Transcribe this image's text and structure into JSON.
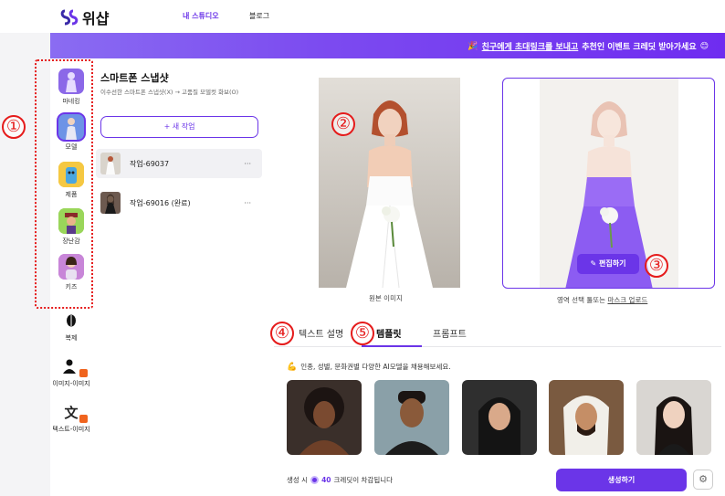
{
  "header": {
    "logo_text": "위샵",
    "nav": [
      {
        "label": "내 스튜디오",
        "active": true
      },
      {
        "label": "블로그",
        "active": false
      }
    ]
  },
  "banner": {
    "text_underlined": "친구에게 초대링크를 보내고",
    "text_rest": "추천인 이벤트 크레딧 받아가세요",
    "emoji": "😊"
  },
  "sidebar": {
    "categories": [
      {
        "label": "마네킹"
      },
      {
        "label": "모델",
        "selected": true
      },
      {
        "label": "제품"
      },
      {
        "label": "장난감"
      },
      {
        "label": "키즈"
      }
    ],
    "tools": [
      {
        "label": "복제"
      },
      {
        "label": "이미지-이미지"
      },
      {
        "label": "텍스트-이미지"
      }
    ]
  },
  "project": {
    "title": "스마트폰 스냅샷",
    "description": "이수선한 스마트폰 스냅샷(X) → 고품질 모델컷 화보(O)",
    "new_button": "+ 새 작업",
    "jobs": [
      {
        "name": "작업-69037",
        "more": "···"
      },
      {
        "name": "작업-69016 (완료)",
        "more": "···"
      }
    ]
  },
  "preview": {
    "original_caption": "원본 이미지",
    "mask_caption_prefix": "영역 선택 툴또는",
    "mask_caption_link": "마스크 업로드",
    "edit_button": "편집하기"
  },
  "tabs": [
    {
      "label": "텍스트 설명"
    },
    {
      "label": "템플릿",
      "active": true
    },
    {
      "label": "프롬프트"
    }
  ],
  "template": {
    "hint": "인종, 성별, 문화권별 다양한 AI모델을 채용해보세요.",
    "avatars": [
      "avatar-1",
      "avatar-2",
      "avatar-3",
      "avatar-4",
      "avatar-5"
    ]
  },
  "footer": {
    "credit_prefix": "생성 시",
    "credit_amount": "40",
    "credit_suffix": "크레딧이 차감됩니다",
    "generate_button": "생성하기",
    "settings_icon": "gear-icon"
  },
  "annotations": [
    "①",
    "②",
    "③",
    "④",
    "⑤"
  ],
  "colors": {
    "accent": "#6b35e8",
    "annotation_red": "#e51b1b"
  }
}
